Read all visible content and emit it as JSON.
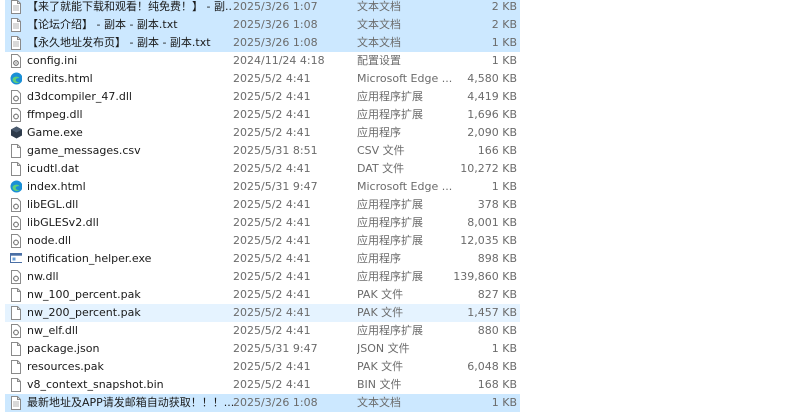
{
  "files": [
    {
      "name": "【来了就能下载和观看！纯免费！】 - 副...",
      "date": "2025/3/26 1:07",
      "type": "文本文档",
      "size": "2 KB",
      "icon": "text-file-icon",
      "state": "sel"
    },
    {
      "name": "【论坛介绍】 - 副本 - 副本.txt",
      "date": "2025/3/26 1:08",
      "type": "文本文档",
      "size": "2 KB",
      "icon": "text-file-icon",
      "state": "sel"
    },
    {
      "name": "【永久地址发布页】 - 副本 - 副本.txt",
      "date": "2025/3/26 1:08",
      "type": "文本文档",
      "size": "1 KB",
      "icon": "text-file-icon",
      "state": "sel"
    },
    {
      "name": "config.ini",
      "date": "2024/11/24 4:18",
      "type": "配置设置",
      "size": "1 KB",
      "icon": "config-file-icon",
      "state": ""
    },
    {
      "name": "credits.html",
      "date": "2025/5/2 4:41",
      "type": "Microsoft Edge ...",
      "size": "4,580 KB",
      "icon": "edge-icon",
      "state": ""
    },
    {
      "name": "d3dcompiler_47.dll",
      "date": "2025/5/2 4:41",
      "type": "应用程序扩展",
      "size": "4,419 KB",
      "icon": "dll-file-icon",
      "state": ""
    },
    {
      "name": "ffmpeg.dll",
      "date": "2025/5/2 4:41",
      "type": "应用程序扩展",
      "size": "1,696 KB",
      "icon": "dll-file-icon",
      "state": ""
    },
    {
      "name": "Game.exe",
      "date": "2025/5/2 4:41",
      "type": "应用程序",
      "size": "2,090 KB",
      "icon": "game-exe-icon",
      "state": ""
    },
    {
      "name": "game_messages.csv",
      "date": "2025/5/31 8:51",
      "type": "CSV 文件",
      "size": "166 KB",
      "icon": "blank-file-icon",
      "state": ""
    },
    {
      "name": "icudtl.dat",
      "date": "2025/5/2 4:41",
      "type": "DAT 文件",
      "size": "10,272 KB",
      "icon": "blank-file-icon",
      "state": ""
    },
    {
      "name": "index.html",
      "date": "2025/5/31 9:47",
      "type": "Microsoft Edge ...",
      "size": "1 KB",
      "icon": "edge-icon",
      "state": ""
    },
    {
      "name": "libEGL.dll",
      "date": "2025/5/2 4:41",
      "type": "应用程序扩展",
      "size": "378 KB",
      "icon": "dll-file-icon",
      "state": ""
    },
    {
      "name": "libGLESv2.dll",
      "date": "2025/5/2 4:41",
      "type": "应用程序扩展",
      "size": "8,001 KB",
      "icon": "dll-file-icon",
      "state": ""
    },
    {
      "name": "node.dll",
      "date": "2025/5/2 4:41",
      "type": "应用程序扩展",
      "size": "12,035 KB",
      "icon": "dll-file-icon",
      "state": ""
    },
    {
      "name": "notification_helper.exe",
      "date": "2025/5/2 4:41",
      "type": "应用程序",
      "size": "898 KB",
      "icon": "exe-window-icon",
      "state": ""
    },
    {
      "name": "nw.dll",
      "date": "2025/5/2 4:41",
      "type": "应用程序扩展",
      "size": "139,860 KB",
      "icon": "dll-file-icon",
      "state": ""
    },
    {
      "name": "nw_100_percent.pak",
      "date": "2025/5/2 4:41",
      "type": "PAK 文件",
      "size": "827 KB",
      "icon": "blank-file-icon",
      "state": ""
    },
    {
      "name": "nw_200_percent.pak",
      "date": "2025/5/2 4:41",
      "type": "PAK 文件",
      "size": "1,457 KB",
      "icon": "blank-file-icon",
      "state": "hover"
    },
    {
      "name": "nw_elf.dll",
      "date": "2025/5/2 4:41",
      "type": "应用程序扩展",
      "size": "880 KB",
      "icon": "dll-file-icon",
      "state": ""
    },
    {
      "name": "package.json",
      "date": "2025/5/31 9:47",
      "type": "JSON 文件",
      "size": "1 KB",
      "icon": "blank-file-icon",
      "state": ""
    },
    {
      "name": "resources.pak",
      "date": "2025/5/2 4:41",
      "type": "PAK 文件",
      "size": "6,048 KB",
      "icon": "blank-file-icon",
      "state": ""
    },
    {
      "name": "v8_context_snapshot.bin",
      "date": "2025/5/2 4:41",
      "type": "BIN 文件",
      "size": "168 KB",
      "icon": "blank-file-icon",
      "state": ""
    },
    {
      "name": "最新地址及APP请发邮箱自动获取！！！...",
      "date": "2025/3/26 1:08",
      "type": "文本文档",
      "size": "1 KB",
      "icon": "text-file-icon",
      "state": "sel"
    }
  ],
  "colors": {
    "selection": "#cce8ff",
    "hover": "#e5f3ff",
    "edge": "#1a8fd6",
    "secondary_text": "#6b6b6b"
  }
}
